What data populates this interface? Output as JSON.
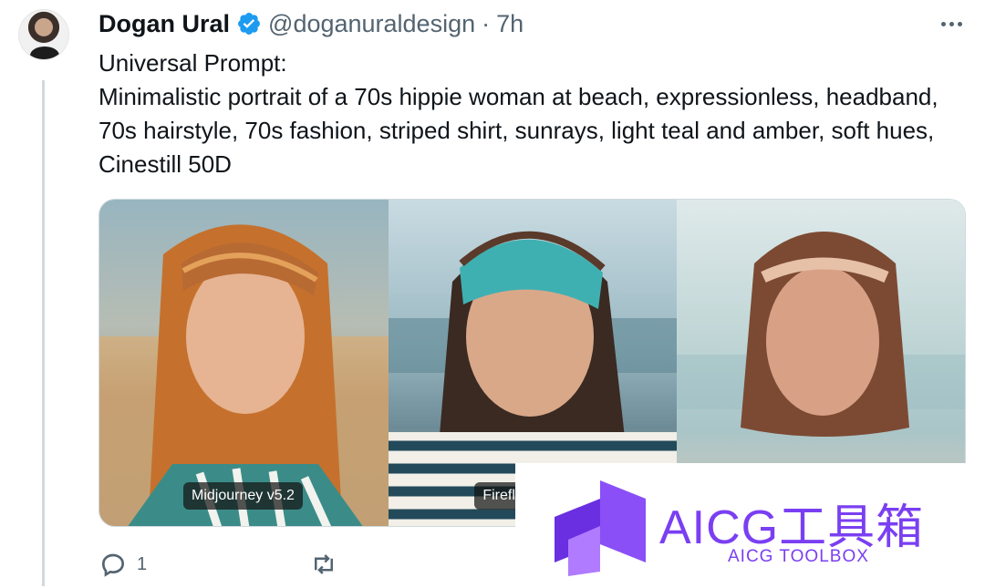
{
  "author": {
    "display_name": "Dogan Ural",
    "handle": "@doganuraldesign",
    "separator": "·",
    "time": "7h"
  },
  "icons": {
    "verified": "verified-badge-icon",
    "more": "more-horizontal-icon",
    "reply": "reply-icon",
    "retweet": "retweet-icon"
  },
  "tweet": {
    "line1": "Universal Prompt:",
    "line2": "Minimalistic portrait of a 70s hippie woman at beach, expressionless, headband, 70s hairstyle, 70s fashion, striped shirt, sunrays, light teal and amber, soft hues, Cinestill 50D"
  },
  "media": {
    "photos": [
      {
        "label": "Midjourney v5.2"
      },
      {
        "label": "Firefl"
      },
      {
        "label": ""
      }
    ]
  },
  "actions": {
    "reply_count": "1",
    "retweet_count": ""
  },
  "watermark": {
    "title": "AICG工具箱",
    "subtitle": "AICG TOOLBOX"
  },
  "colors": {
    "verified": "#1d9bf0",
    "secondary_text": "#536471",
    "watermark": "#7a3ff2"
  }
}
